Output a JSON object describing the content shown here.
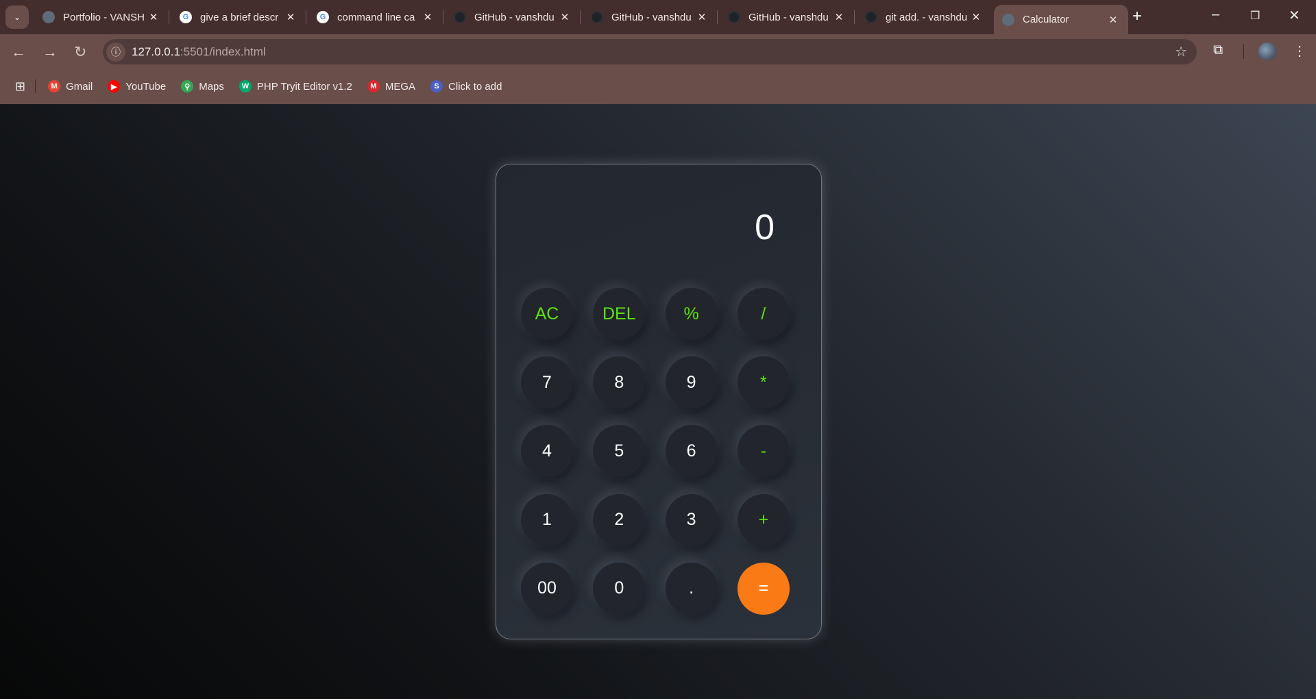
{
  "browser": {
    "tabs": [
      {
        "title": "Portfolio - VANSH",
        "icon": "globe-icon"
      },
      {
        "title": "give a brief descr",
        "icon": "google-icon"
      },
      {
        "title": "command line ca",
        "icon": "google-icon"
      },
      {
        "title": "GitHub - vanshdu",
        "icon": "github-icon"
      },
      {
        "title": "GitHub - vanshdu",
        "icon": "github-icon"
      },
      {
        "title": "GitHub - vanshdu",
        "icon": "github-icon"
      },
      {
        "title": "git add. - vanshdu",
        "icon": "github-icon"
      },
      {
        "title": "Calculator",
        "icon": "globe-icon",
        "active": true
      }
    ],
    "url_host": "127.0.0.1",
    "url_rest": ":5501/index.html",
    "bookmarks": [
      {
        "label": "Gmail",
        "color": "#ea4335",
        "glyph": "M"
      },
      {
        "label": "YouTube",
        "color": "#ff0000",
        "glyph": "▶"
      },
      {
        "label": "Maps",
        "color": "#34a853",
        "glyph": "⚲"
      },
      {
        "label": "PHP Tryit Editor v1.2",
        "color": "#04aa6d",
        "glyph": "W"
      },
      {
        "label": "MEGA",
        "color": "#d9272e",
        "glyph": "M"
      },
      {
        "label": "Click to add",
        "color": "#4a5fc1",
        "glyph": "S"
      }
    ]
  },
  "calculator": {
    "display": "0",
    "buttons": [
      {
        "label": "AC",
        "type": "op"
      },
      {
        "label": "DEL",
        "type": "op"
      },
      {
        "label": "%",
        "type": "op"
      },
      {
        "label": "/",
        "type": "op"
      },
      {
        "label": "7",
        "type": "num"
      },
      {
        "label": "8",
        "type": "num"
      },
      {
        "label": "9",
        "type": "num"
      },
      {
        "label": "*",
        "type": "op"
      },
      {
        "label": "4",
        "type": "num"
      },
      {
        "label": "5",
        "type": "num"
      },
      {
        "label": "6",
        "type": "num"
      },
      {
        "label": "-",
        "type": "op"
      },
      {
        "label": "1",
        "type": "num"
      },
      {
        "label": "2",
        "type": "num"
      },
      {
        "label": "3",
        "type": "num"
      },
      {
        "label": "+",
        "type": "op"
      },
      {
        "label": "00",
        "type": "num"
      },
      {
        "label": "0",
        "type": "num"
      },
      {
        "label": ".",
        "type": "num"
      },
      {
        "label": "=",
        "type": "eq"
      }
    ],
    "colors": {
      "operator": "#5ee116",
      "equals": "#fa7b16"
    }
  }
}
